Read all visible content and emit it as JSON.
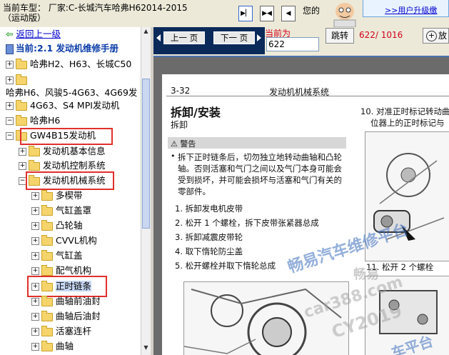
{
  "header": {
    "car_model": "当前车型：  厂家:C-长城汽车哈弗H62014-2015（运动版）",
    "user_text": "您的",
    "upgrade_link": ">>用户升级缴"
  },
  "sidebar": {
    "back_link": "返回上一级",
    "current": "当前:2.1 发动机维修手册",
    "items": [
      "哈弗H2、H63、长城C50",
      "哈弗H6、风骏5-4G63、4G69发",
      "4G63、S4 MPI发动机",
      "哈弗H6",
      "GW4B15发动机",
      "发动机基本信息",
      "发动机控制系统",
      "发动机机械系统",
      "多楔带",
      "气缸盖罩",
      "凸轮轴",
      "CVVL机构",
      "气缸盖",
      "配气机构",
      "正时链条",
      "曲轴前油封",
      "曲轴后油封",
      "活塞连杆",
      "曲轴"
    ]
  },
  "toolbar": {
    "prev_label": "上一 页",
    "next_label": "下一 页",
    "current_label": "当前为",
    "page_value": "622",
    "jump_label": "跳转",
    "page_count": "622/ 1016",
    "zoom_label": "放"
  },
  "doc": {
    "page_no": "3-32",
    "header_title": "发动机机械系统",
    "section_title": "拆卸/安装",
    "sub_title": "拆卸",
    "warning_title": "警告",
    "warning_lines": [
      "拆下正时链条后，切勿独立地转动曲轴和凸轮",
      "轴。否则活塞和气门之间以及气门本身可能会",
      "受到损坏，并可能会损坏与活塞和气门有关的",
      "零部件。"
    ],
    "steps": [
      "1. 拆卸发电机皮带",
      "2. 松开 1 个螺栓，拆下皮带张紧器总成",
      "3. 拆卸减震皮带轮",
      "4. 取下惰轮防尘盖",
      "5. 松开螺栓并取下惰轮总成"
    ],
    "right_step_10_a": "10. 对准正时标记转动曲",
    "right_step_10_b": "位器上的正时标记与",
    "right_step_11": "11. 松开 2 个螺栓",
    "watermark_main": "畅易汽车维修平台",
    "watermark_sub": "畅易",
    "watermark_url": "car388.com",
    "watermark_cy": "CY2019",
    "watermark_bottom": "车平台"
  },
  "colors": {
    "highlight": "#e0302c",
    "nav_frame": "#0b2a5a",
    "count_red": "#d0021b"
  }
}
